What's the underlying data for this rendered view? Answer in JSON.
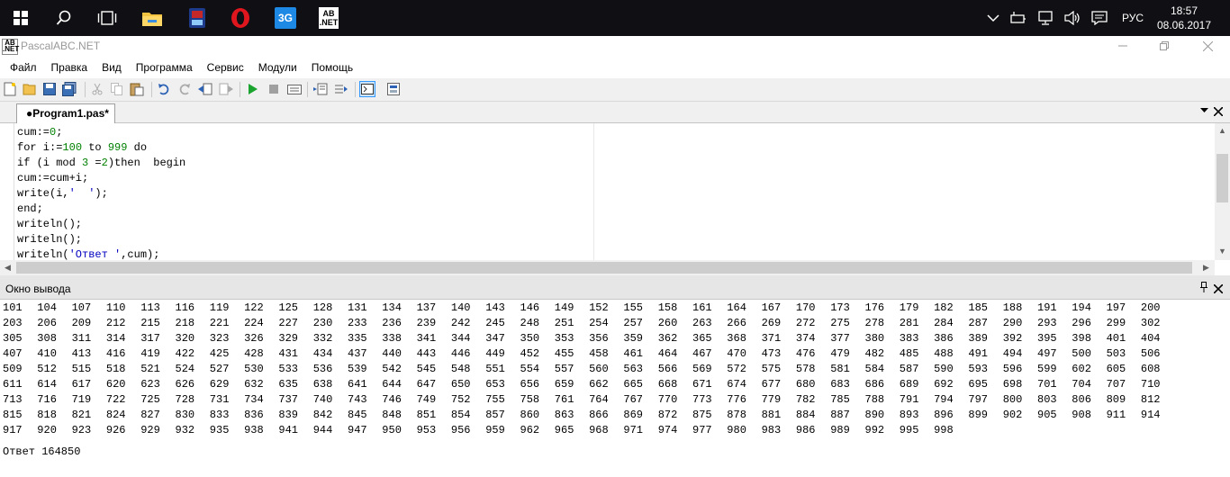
{
  "taskbar": {
    "apps": [
      {
        "name": "start-icon"
      },
      {
        "name": "search-icon"
      },
      {
        "name": "task-view-icon"
      },
      {
        "name": "file-explorer-icon"
      },
      {
        "name": "media-app-icon"
      },
      {
        "name": "opera-icon"
      },
      {
        "name": "3g-modem-icon",
        "label": "3G"
      },
      {
        "name": "pascalabc-taskbar-icon",
        "label": "AB .NET"
      }
    ],
    "language": "РУС",
    "time": "18:57",
    "date": "08.06.2017"
  },
  "window": {
    "title": "PascalABC.NET",
    "icon_label": "AB .NET"
  },
  "menu": [
    "Файл",
    "Правка",
    "Вид",
    "Программа",
    "Сервис",
    "Модули",
    "Помощь"
  ],
  "tab": {
    "label": "●Program1.pas*"
  },
  "editor": {
    "lines": [
      "cum:=0;",
      "for i:=100 to 999 do",
      "if (i mod 3 =2)then  begin",
      "cum:=cum+i;",
      "write(i,'  ');",
      "end;",
      "writeln();",
      "writeln();",
      "writeln('Ответ ',cum);"
    ]
  },
  "output_panel": {
    "title": "Окно вывода",
    "rows": [
      [
        101,
        104,
        107,
        110,
        113,
        116,
        119,
        122,
        125,
        128,
        131,
        134,
        137,
        140,
        143,
        146,
        149,
        152,
        155,
        158,
        161,
        164,
        167,
        170,
        173,
        176,
        179,
        182,
        185,
        188,
        191,
        194,
        197,
        200
      ],
      [
        203,
        206,
        209,
        212,
        215,
        218,
        221,
        224,
        227,
        230,
        233,
        236,
        239,
        242,
        245,
        248,
        251,
        254,
        257,
        260,
        263,
        266,
        269,
        272,
        275,
        278,
        281,
        284,
        287,
        290,
        293,
        296,
        299,
        302
      ],
      [
        305,
        308,
        311,
        314,
        317,
        320,
        323,
        326,
        329,
        332,
        335,
        338,
        341,
        344,
        347,
        350,
        353,
        356,
        359,
        362,
        365,
        368,
        371,
        374,
        377,
        380,
        383,
        386,
        389,
        392,
        395,
        398,
        401,
        404
      ],
      [
        407,
        410,
        413,
        416,
        419,
        422,
        425,
        428,
        431,
        434,
        437,
        440,
        443,
        446,
        449,
        452,
        455,
        458,
        461,
        464,
        467,
        470,
        473,
        476,
        479,
        482,
        485,
        488,
        491,
        494,
        497,
        500,
        503,
        506
      ],
      [
        509,
        512,
        515,
        518,
        521,
        524,
        527,
        530,
        533,
        536,
        539,
        542,
        545,
        548,
        551,
        554,
        557,
        560,
        563,
        566,
        569,
        572,
        575,
        578,
        581,
        584,
        587,
        590,
        593,
        596,
        599,
        602,
        605,
        608
      ],
      [
        611,
        614,
        617,
        620,
        623,
        626,
        629,
        632,
        635,
        638,
        641,
        644,
        647,
        650,
        653,
        656,
        659,
        662,
        665,
        668,
        671,
        674,
        677,
        680,
        683,
        686,
        689,
        692,
        695,
        698,
        701,
        704,
        707,
        710
      ],
      [
        713,
        716,
        719,
        722,
        725,
        728,
        731,
        734,
        737,
        740,
        743,
        746,
        749,
        752,
        755,
        758,
        761,
        764,
        767,
        770,
        773,
        776,
        779,
        782,
        785,
        788,
        791,
        794,
        797,
        800,
        803,
        806,
        809,
        812
      ],
      [
        815,
        818,
        821,
        824,
        827,
        830,
        833,
        836,
        839,
        842,
        845,
        848,
        851,
        854,
        857,
        860,
        863,
        866,
        869,
        872,
        875,
        878,
        881,
        884,
        887,
        890,
        893,
        896,
        899,
        902,
        905,
        908,
        911,
        914
      ],
      [
        917,
        920,
        923,
        926,
        929,
        932,
        935,
        938,
        941,
        944,
        947,
        950,
        953,
        956,
        959,
        962,
        965,
        968,
        971,
        974,
        977,
        980,
        983,
        986,
        989,
        992,
        995,
        998
      ]
    ],
    "answer": "Ответ 164850"
  }
}
